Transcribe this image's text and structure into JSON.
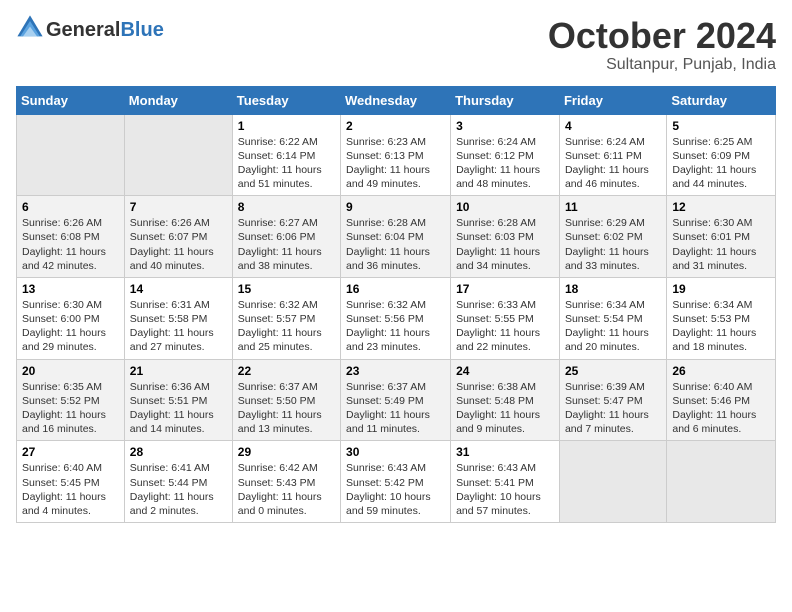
{
  "header": {
    "logo_line1": "General",
    "logo_line2": "Blue",
    "month": "October 2024",
    "location": "Sultanpur, Punjab, India"
  },
  "days_of_week": [
    "Sunday",
    "Monday",
    "Tuesday",
    "Wednesday",
    "Thursday",
    "Friday",
    "Saturday"
  ],
  "weeks": [
    [
      {
        "day": "",
        "content": ""
      },
      {
        "day": "",
        "content": ""
      },
      {
        "day": "1",
        "content": "Sunrise: 6:22 AM\nSunset: 6:14 PM\nDaylight: 11 hours and 51 minutes."
      },
      {
        "day": "2",
        "content": "Sunrise: 6:23 AM\nSunset: 6:13 PM\nDaylight: 11 hours and 49 minutes."
      },
      {
        "day": "3",
        "content": "Sunrise: 6:24 AM\nSunset: 6:12 PM\nDaylight: 11 hours and 48 minutes."
      },
      {
        "day": "4",
        "content": "Sunrise: 6:24 AM\nSunset: 6:11 PM\nDaylight: 11 hours and 46 minutes."
      },
      {
        "day": "5",
        "content": "Sunrise: 6:25 AM\nSunset: 6:09 PM\nDaylight: 11 hours and 44 minutes."
      }
    ],
    [
      {
        "day": "6",
        "content": "Sunrise: 6:26 AM\nSunset: 6:08 PM\nDaylight: 11 hours and 42 minutes."
      },
      {
        "day": "7",
        "content": "Sunrise: 6:26 AM\nSunset: 6:07 PM\nDaylight: 11 hours and 40 minutes."
      },
      {
        "day": "8",
        "content": "Sunrise: 6:27 AM\nSunset: 6:06 PM\nDaylight: 11 hours and 38 minutes."
      },
      {
        "day": "9",
        "content": "Sunrise: 6:28 AM\nSunset: 6:04 PM\nDaylight: 11 hours and 36 minutes."
      },
      {
        "day": "10",
        "content": "Sunrise: 6:28 AM\nSunset: 6:03 PM\nDaylight: 11 hours and 34 minutes."
      },
      {
        "day": "11",
        "content": "Sunrise: 6:29 AM\nSunset: 6:02 PM\nDaylight: 11 hours and 33 minutes."
      },
      {
        "day": "12",
        "content": "Sunrise: 6:30 AM\nSunset: 6:01 PM\nDaylight: 11 hours and 31 minutes."
      }
    ],
    [
      {
        "day": "13",
        "content": "Sunrise: 6:30 AM\nSunset: 6:00 PM\nDaylight: 11 hours and 29 minutes."
      },
      {
        "day": "14",
        "content": "Sunrise: 6:31 AM\nSunset: 5:58 PM\nDaylight: 11 hours and 27 minutes."
      },
      {
        "day": "15",
        "content": "Sunrise: 6:32 AM\nSunset: 5:57 PM\nDaylight: 11 hours and 25 minutes."
      },
      {
        "day": "16",
        "content": "Sunrise: 6:32 AM\nSunset: 5:56 PM\nDaylight: 11 hours and 23 minutes."
      },
      {
        "day": "17",
        "content": "Sunrise: 6:33 AM\nSunset: 5:55 PM\nDaylight: 11 hours and 22 minutes."
      },
      {
        "day": "18",
        "content": "Sunrise: 6:34 AM\nSunset: 5:54 PM\nDaylight: 11 hours and 20 minutes."
      },
      {
        "day": "19",
        "content": "Sunrise: 6:34 AM\nSunset: 5:53 PM\nDaylight: 11 hours and 18 minutes."
      }
    ],
    [
      {
        "day": "20",
        "content": "Sunrise: 6:35 AM\nSunset: 5:52 PM\nDaylight: 11 hours and 16 minutes."
      },
      {
        "day": "21",
        "content": "Sunrise: 6:36 AM\nSunset: 5:51 PM\nDaylight: 11 hours and 14 minutes."
      },
      {
        "day": "22",
        "content": "Sunrise: 6:37 AM\nSunset: 5:50 PM\nDaylight: 11 hours and 13 minutes."
      },
      {
        "day": "23",
        "content": "Sunrise: 6:37 AM\nSunset: 5:49 PM\nDaylight: 11 hours and 11 minutes."
      },
      {
        "day": "24",
        "content": "Sunrise: 6:38 AM\nSunset: 5:48 PM\nDaylight: 11 hours and 9 minutes."
      },
      {
        "day": "25",
        "content": "Sunrise: 6:39 AM\nSunset: 5:47 PM\nDaylight: 11 hours and 7 minutes."
      },
      {
        "day": "26",
        "content": "Sunrise: 6:40 AM\nSunset: 5:46 PM\nDaylight: 11 hours and 6 minutes."
      }
    ],
    [
      {
        "day": "27",
        "content": "Sunrise: 6:40 AM\nSunset: 5:45 PM\nDaylight: 11 hours and 4 minutes."
      },
      {
        "day": "28",
        "content": "Sunrise: 6:41 AM\nSunset: 5:44 PM\nDaylight: 11 hours and 2 minutes."
      },
      {
        "day": "29",
        "content": "Sunrise: 6:42 AM\nSunset: 5:43 PM\nDaylight: 11 hours and 0 minutes."
      },
      {
        "day": "30",
        "content": "Sunrise: 6:43 AM\nSunset: 5:42 PM\nDaylight: 10 hours and 59 minutes."
      },
      {
        "day": "31",
        "content": "Sunrise: 6:43 AM\nSunset: 5:41 PM\nDaylight: 10 hours and 57 minutes."
      },
      {
        "day": "",
        "content": ""
      },
      {
        "day": "",
        "content": ""
      }
    ]
  ]
}
